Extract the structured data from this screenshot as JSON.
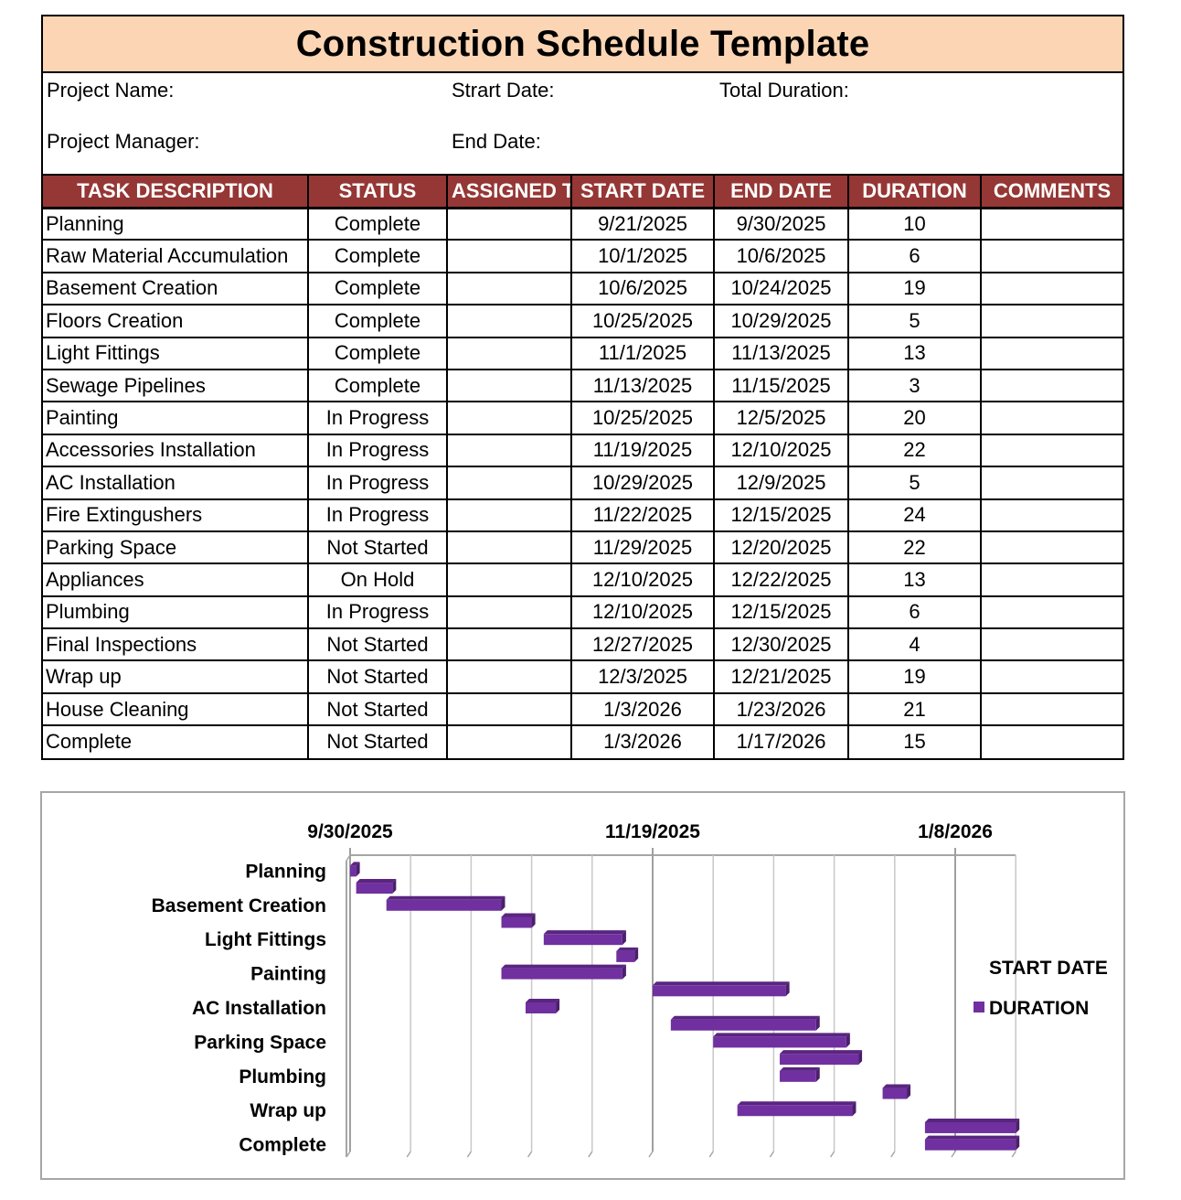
{
  "title": "Construction Schedule Template",
  "info": {
    "project_name_label": "Project Name:",
    "start_date_label": "Strart Date:",
    "total_duration_label": "Total Duration:",
    "project_manager_label": "Project Manager:",
    "end_date_label": "End Date:"
  },
  "colors": {
    "title_band": "#FCD5B4",
    "header": "#953735",
    "bar": "#7030A0"
  },
  "table": {
    "columns": [
      "TASK DESCRIPTION",
      "STATUS",
      "ASSIGNED TO",
      "START DATE",
      "END DATE",
      "DURATION",
      "COMMENTS"
    ],
    "rows": [
      {
        "task": "Planning",
        "status": "Complete",
        "assigned": "",
        "start": "9/21/2025",
        "end": "9/30/2025",
        "duration": "10",
        "comments": ""
      },
      {
        "task": "Raw Material Accumulation",
        "status": "Complete",
        "assigned": "",
        "start": "10/1/2025",
        "end": "10/6/2025",
        "duration": "6",
        "comments": ""
      },
      {
        "task": "Basement Creation",
        "status": "Complete",
        "assigned": "",
        "start": "10/6/2025",
        "end": "10/24/2025",
        "duration": "19",
        "comments": ""
      },
      {
        "task": "Floors Creation",
        "status": "Complete",
        "assigned": "",
        "start": "10/25/2025",
        "end": "10/29/2025",
        "duration": "5",
        "comments": ""
      },
      {
        "task": "Light Fittings",
        "status": "Complete",
        "assigned": "",
        "start": "11/1/2025",
        "end": "11/13/2025",
        "duration": "13",
        "comments": ""
      },
      {
        "task": "Sewage Pipelines",
        "status": "Complete",
        "assigned": "",
        "start": "11/13/2025",
        "end": "11/15/2025",
        "duration": "3",
        "comments": ""
      },
      {
        "task": "Painting",
        "status": "In Progress",
        "assigned": "",
        "start": "10/25/2025",
        "end": "12/5/2025",
        "duration": "20",
        "comments": ""
      },
      {
        "task": "Accessories Installation",
        "status": "In Progress",
        "assigned": "",
        "start": "11/19/2025",
        "end": "12/10/2025",
        "duration": "22",
        "comments": ""
      },
      {
        "task": "AC Installation",
        "status": "In Progress",
        "assigned": "",
        "start": "10/29/2025",
        "end": "12/9/2025",
        "duration": "5",
        "comments": ""
      },
      {
        "task": "Fire Extingushers",
        "status": "In Progress",
        "assigned": "",
        "start": "11/22/2025",
        "end": "12/15/2025",
        "duration": "24",
        "comments": ""
      },
      {
        "task": "Parking Space",
        "status": "Not Started",
        "assigned": "",
        "start": "11/29/2025",
        "end": "12/20/2025",
        "duration": "22",
        "comments": ""
      },
      {
        "task": "Appliances",
        "status": "On Hold",
        "assigned": "",
        "start": "12/10/2025",
        "end": "12/22/2025",
        "duration": "13",
        "comments": ""
      },
      {
        "task": "Plumbing",
        "status": "In Progress",
        "assigned": "",
        "start": "12/10/2025",
        "end": "12/15/2025",
        "duration": "6",
        "comments": ""
      },
      {
        "task": "Final Inspections",
        "status": "Not Started",
        "assigned": "",
        "start": "12/27/2025",
        "end": "12/30/2025",
        "duration": "4",
        "comments": ""
      },
      {
        "task": "Wrap up",
        "status": "Not Started",
        "assigned": "",
        "start": "12/3/2025",
        "end": "12/21/2025",
        "duration": "19",
        "comments": ""
      },
      {
        "task": "House Cleaning",
        "status": "Not Started",
        "assigned": "",
        "start": "1/3/2026",
        "end": "1/23/2026",
        "duration": "21",
        "comments": ""
      },
      {
        "task": "Complete",
        "status": "Not Started",
        "assigned": "",
        "start": "1/3/2026",
        "end": "1/17/2026",
        "duration": "15",
        "comments": ""
      }
    ]
  },
  "chart_data": {
    "type": "bar",
    "orientation": "horizontal-stacked-gantt",
    "title": "",
    "categories": [
      "Planning",
      "Raw Material Accumulation",
      "Basement Creation",
      "Floors Creation",
      "Light Fittings",
      "Sewage Pipelines",
      "Painting",
      "Accessories Installation",
      "AC Installation",
      "Fire Extingushers",
      "Parking Space",
      "Appliances",
      "Plumbing",
      "Final Inspections",
      "Wrap up",
      "House Cleaning",
      "Complete"
    ],
    "visible_category_labels": [
      "Planning",
      "Basement Creation",
      "Light Fittings",
      "Painting",
      "AC Installation",
      "Parking Space",
      "Plumbing",
      "Wrap up",
      "Complete"
    ],
    "series": [
      {
        "name": "START DATE",
        "visible": false,
        "values": [
          "9/21/2025",
          "10/1/2025",
          "10/6/2025",
          "10/25/2025",
          "11/1/2025",
          "11/13/2025",
          "10/25/2025",
          "11/19/2025",
          "10/29/2025",
          "11/22/2025",
          "11/29/2025",
          "12/10/2025",
          "12/10/2025",
          "12/27/2025",
          "12/3/2025",
          "1/3/2026",
          "1/3/2026"
        ]
      },
      {
        "name": "DURATION",
        "visible": true,
        "values": [
          10,
          6,
          19,
          5,
          13,
          3,
          20,
          22,
          5,
          24,
          22,
          13,
          6,
          4,
          19,
          21,
          15
        ]
      }
    ],
    "x_tick_labels": [
      "9/30/2025",
      "11/19/2025",
      "1/8/2026"
    ],
    "xlim": [
      "9/30/2025",
      "1/18/2026"
    ],
    "x_major_unit_days": 50,
    "x_minor_unit_days": 10,
    "grid": true,
    "legend": {
      "position": "right",
      "entries": [
        "START DATE",
        "DURATION"
      ]
    },
    "xlabel": "",
    "ylabel": ""
  }
}
